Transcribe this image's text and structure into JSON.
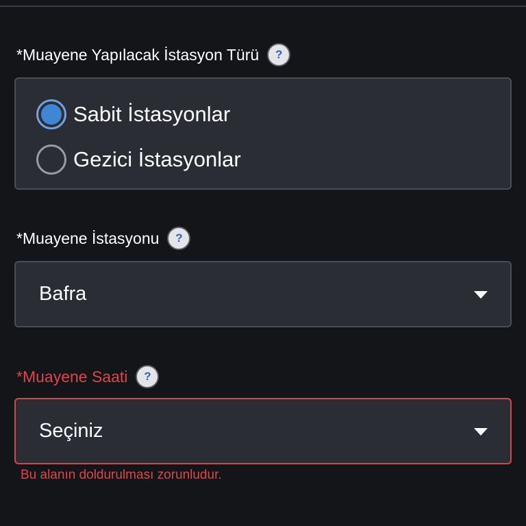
{
  "station_type": {
    "label": "*Muayene Yapılacak İstasyon Türü",
    "help": "?",
    "options": [
      {
        "label": "Sabit İstasyonlar",
        "checked": true
      },
      {
        "label": "Gezici İstasyonlar",
        "checked": false
      }
    ]
  },
  "station": {
    "label": "*Muayene İstasyonu",
    "help": "?",
    "value": "Bafra"
  },
  "time": {
    "label": "*Muayene Saati",
    "help": "?",
    "value": "Seçiniz",
    "error": "Bu alanın doldurulması zorunludur."
  },
  "colors": {
    "background": "#141518",
    "panel": "#2a2d33",
    "accent": "#3f86d6",
    "error": "#e0454a"
  }
}
